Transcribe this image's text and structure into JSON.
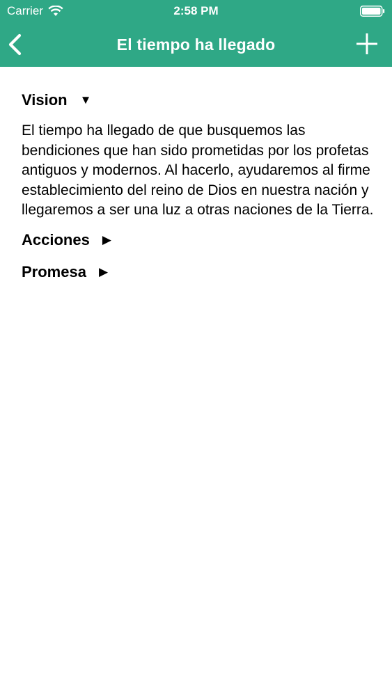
{
  "status_bar": {
    "carrier": "Carrier",
    "time": "2:58 PM",
    "icons": [
      "wifi-icon",
      "battery-icon"
    ]
  },
  "nav_bar": {
    "title": "El tiempo ha llegado",
    "back_icon": "chevron-left-icon",
    "add_icon": "plus-icon",
    "background_color": "#2fa886",
    "text_color": "#ffffff"
  },
  "sections": [
    {
      "title": "Vision",
      "expanded": true,
      "toggle_glyph": "▼",
      "body": "El tiempo ha llegado de que busquemos las bendiciones que han sido prometidas por los profetas antiguos y modernos. Al hacerlo, ayudaremos al firme establecimiento del reino de Dios en nuestra nación y llegaremos a ser una luz a otras naciones de la Tierra."
    },
    {
      "title": "Acciones",
      "expanded": false,
      "toggle_glyph": "▶"
    },
    {
      "title": "Promesa",
      "expanded": false,
      "toggle_glyph": "▶"
    }
  ]
}
